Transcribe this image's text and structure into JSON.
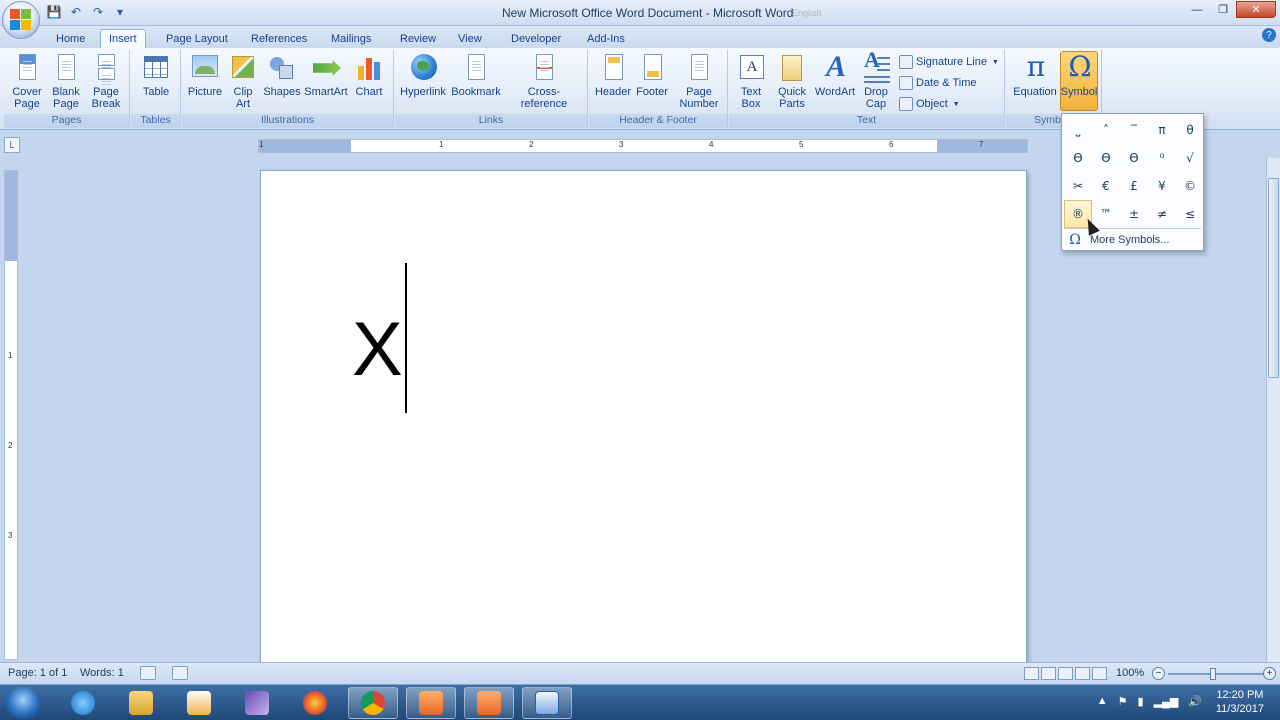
{
  "window": {
    "title": "New Microsoft Office Word Document - Microsoft Word",
    "overlay_text": "English"
  },
  "tabs": [
    "Home",
    "Insert",
    "Page Layout",
    "References",
    "Mailings",
    "Review",
    "View",
    "Developer",
    "Add-Ins"
  ],
  "ribbon": {
    "pages": {
      "label": "Pages",
      "cover_page": "Cover\nPage",
      "blank_page": "Blank\nPage",
      "page_break": "Page\nBreak"
    },
    "tables": {
      "label": "Tables",
      "table": "Table"
    },
    "illustrations": {
      "label": "Illustrations",
      "picture": "Picture",
      "clip_art": "Clip\nArt",
      "shapes": "Shapes",
      "smartart": "SmartArt",
      "chart": "Chart"
    },
    "links": {
      "label": "Links",
      "hyperlink": "Hyperlink",
      "bookmark": "Bookmark",
      "cross_reference": "Cross-reference"
    },
    "header_footer": {
      "label": "Header & Footer",
      "header": "Header",
      "footer": "Footer",
      "page_number": "Page\nNumber"
    },
    "text": {
      "label": "Text",
      "text_box": "Text\nBox",
      "quick_parts": "Quick\nParts",
      "wordart": "WordArt",
      "drop_cap": "Drop\nCap",
      "signature_line": "Signature Line",
      "date_time": "Date & Time",
      "object": "Object"
    },
    "symbols": {
      "label": "Symb",
      "equation": "Equation",
      "symbol": "Symbol"
    }
  },
  "ruler_numbers": [
    "1",
    "1",
    "2",
    "3",
    "4",
    "5",
    "6",
    "7"
  ],
  "vruler_numbers": [
    "1",
    "2",
    "3"
  ],
  "document": {
    "text": "X"
  },
  "symbol_menu": {
    "symbols": [
      "⎵",
      "˄",
      "‾",
      "π",
      "θ",
      "ϴ",
      "ϴ",
      "ϴ",
      "⁰",
      "√",
      "✂",
      "€",
      "£",
      "¥",
      "©",
      "®",
      "™",
      "±",
      "≠",
      "≤"
    ],
    "more_symbols": "More Symbols...",
    "omega": "Ω"
  },
  "status": {
    "page": "Page: 1 of 1",
    "words": "Words: 1",
    "zoom": "100%"
  },
  "clock": {
    "time": "12:20 PM",
    "date": "11/3/2017"
  },
  "colors": {
    "accent": "#15428b",
    "ribbon_bg": "#e3ecf8",
    "workspace": "#c3d6ee"
  }
}
